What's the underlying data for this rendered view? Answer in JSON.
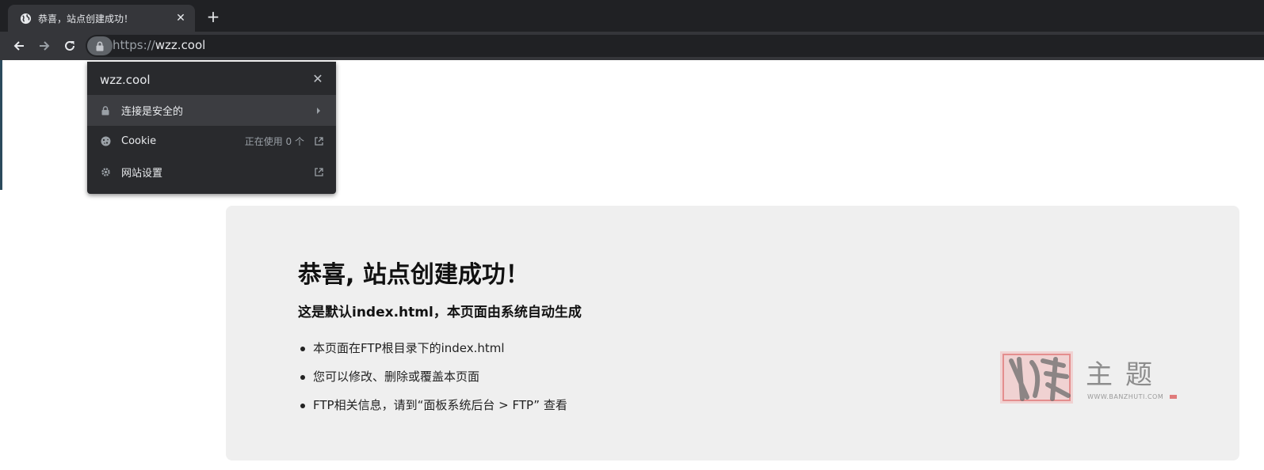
{
  "browser": {
    "tab_title": "恭喜，站点创建成功！",
    "tab_close": "✕",
    "new_tab": "+",
    "url_scheme": "https://",
    "url_host": "wzz.cool"
  },
  "site_info_popup": {
    "domain": "wzz.cool",
    "close": "✕",
    "rows": [
      {
        "label": "连接是安全的",
        "icon": "lock-icon",
        "trail": "chevron-right-icon"
      },
      {
        "label": "Cookie",
        "meta": "正在使用 0 个",
        "icon": "cookie-icon",
        "trail": "open-external-icon"
      },
      {
        "label": "网站设置",
        "icon": "gear-icon",
        "trail": "open-external-icon"
      }
    ]
  },
  "page": {
    "heading": "恭喜, 站点创建成功！",
    "subheading": "这是默认index.html，本页面由系统自动生成",
    "items": [
      "本页面在FTP根目录下的index.html",
      "您可以修改、删除或覆盖本页面",
      "FTP相关信息，请到“面板系统后台 > FTP” 查看"
    ]
  },
  "watermark": {
    "title": "主题",
    "url": "WWW.BANZHUTI.COM"
  },
  "colors": {
    "tabstrip": "#202124",
    "toolbar": "#35363a",
    "popup_bg": "#292a2d",
    "popup_highlight": "#3c3d41",
    "card_bg": "#efefef",
    "watermark_red": "#d84a4a"
  }
}
